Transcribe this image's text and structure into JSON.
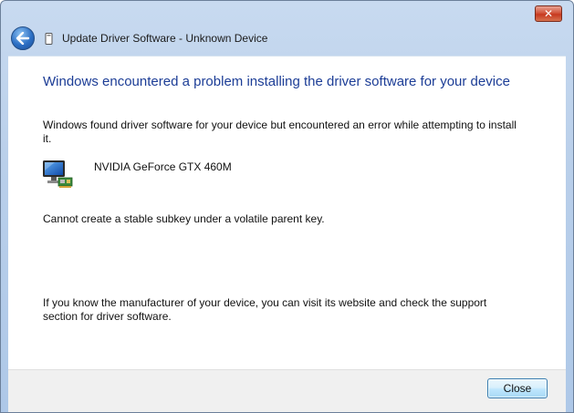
{
  "window": {
    "title": "Update Driver Software - Unknown Device",
    "close_glyph": "✕"
  },
  "content": {
    "headline": "Windows encountered a problem installing the driver software for your device",
    "description": "Windows found driver software for your device but encountered an error while attempting to install it.",
    "device_name": "NVIDIA GeForce GTX 460M",
    "error_message": "Cannot create a stable subkey under a volatile parent key.",
    "help_text": "If you know the manufacturer of your device, you can visit its website and check the support section for driver software."
  },
  "footer": {
    "close_label": "Close"
  },
  "icons": {
    "back": "back-arrow-icon",
    "device_small": "device-icon",
    "device": "display-adapter-icon"
  },
  "colors": {
    "headline": "#1c3d96",
    "titlebar": "#b9cfea",
    "close_red": "#c7391f",
    "button_border": "#3c7fb1"
  }
}
